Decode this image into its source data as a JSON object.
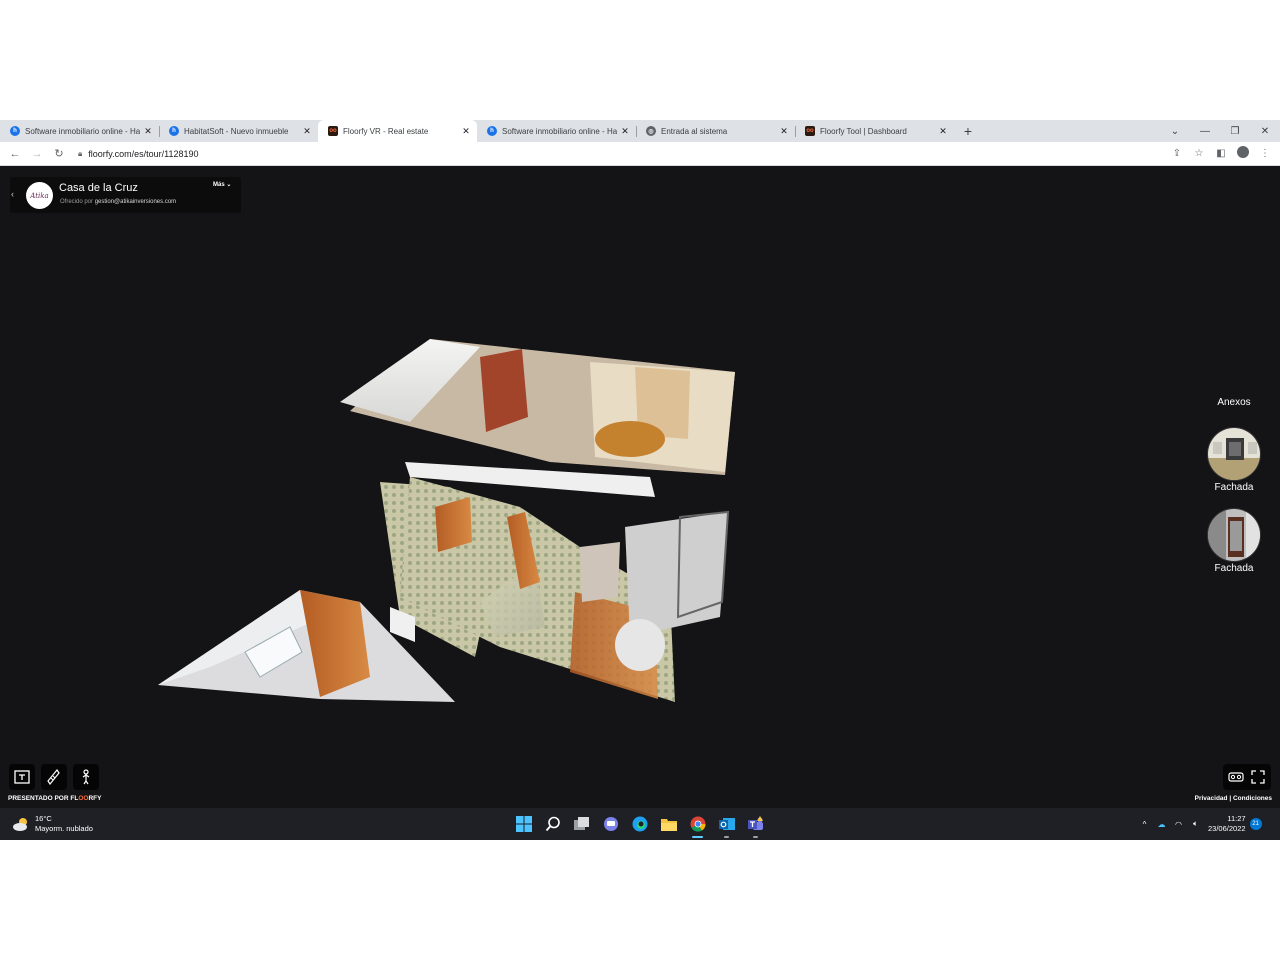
{
  "browser": {
    "tabs": [
      {
        "title": "Software inmobiliario online - Ha",
        "favicon": "habitatsoft-icon",
        "active": false
      },
      {
        "title": "HabitatSoft - Nuevo inmueble",
        "favicon": "habitatsoft-icon",
        "active": false
      },
      {
        "title": "Floorfy VR - Real estate",
        "favicon": "floorfy-icon",
        "active": true
      },
      {
        "title": "Software inmobiliario online - Ha",
        "favicon": "habitatsoft-icon",
        "active": false
      },
      {
        "title": "Entrada al sistema",
        "favicon": "globe-icon",
        "active": false
      },
      {
        "title": "Floorfy Tool | Dashboard",
        "favicon": "floorfy-icon",
        "active": false
      }
    ],
    "url": "floorfy.com/es/tour/1128190"
  },
  "tour": {
    "title": "Casa de la Cruz",
    "offered_prefix": "Ofrecido por",
    "offered_email": "gestion@atikainversiones.com",
    "agency_logo_text": "Atika",
    "more_label": "Más"
  },
  "annexes": {
    "title": "Anexos",
    "items": [
      {
        "label": "Fachada"
      },
      {
        "label": "Fachada"
      }
    ]
  },
  "footer": {
    "powered_prefix": "PRESENTADO POR",
    "powered_brand_a": "FL",
    "powered_brand_b": "OO",
    "powered_brand_c": "RFY",
    "privacy": "Privacidad",
    "separator": "|",
    "conditions": "Condiciones"
  },
  "taskbar": {
    "temperature": "16°C",
    "weather": "Mayorm. nublado",
    "time": "11:27",
    "date": "23/06/2022",
    "notifications": "21"
  },
  "colors": {
    "viewer_bg": "#141416",
    "floorfy_accent": "#ff6a3d",
    "taskbar_bg": "#1e2026"
  }
}
